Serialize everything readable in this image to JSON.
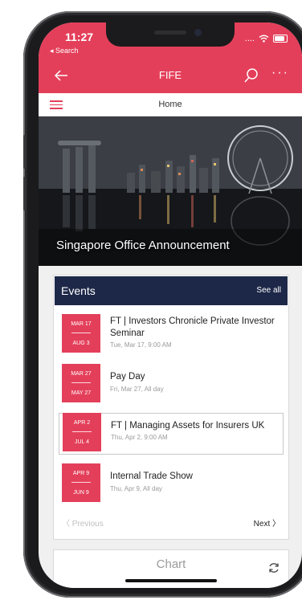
{
  "status": {
    "time": "11:27",
    "back_app": "◂ Search",
    "signal": "....",
    "wifi": "wifi-icon",
    "battery": "battery-icon"
  },
  "navbar": {
    "title": "FIFE",
    "back_icon": "back-arrow-icon",
    "search_icon": "search-icon",
    "more_icon": "more-icon",
    "more_label": "···"
  },
  "subnav": {
    "title": "Home",
    "menu_icon": "hamburger-menu-icon"
  },
  "hero": {
    "title": "Singapore Office Announcement"
  },
  "events": {
    "title": "Events",
    "see_all": "See all",
    "items": [
      {
        "date_start": "MAR 17",
        "date_end": "AUG 3",
        "title": "FT | Investors Chronicle Private Investor Seminar",
        "subtitle": "Tue, Mar 17, 9:00 AM"
      },
      {
        "date_start": "MAR 27",
        "date_end": "MAY 27",
        "title": "Pay Day",
        "subtitle": "Fri, Mar 27, All day"
      },
      {
        "date_start": "APR 2",
        "date_end": "JUL 4",
        "title": "FT | Managing Assets for Insurers UK",
        "subtitle": "Thu, Apr 2, 9:00 AM"
      },
      {
        "date_start": "APR 9",
        "date_end": "JUN 9",
        "title": "Internal Trade Show",
        "subtitle": "Thu, Apr 9, All day"
      }
    ],
    "previous": "Previous",
    "next": "Next"
  },
  "chart_card": {
    "title": "Chart",
    "refresh_icon": "refresh-icon"
  },
  "colors": {
    "accent": "#e43f5a",
    "header_dark": "#1d2848"
  }
}
